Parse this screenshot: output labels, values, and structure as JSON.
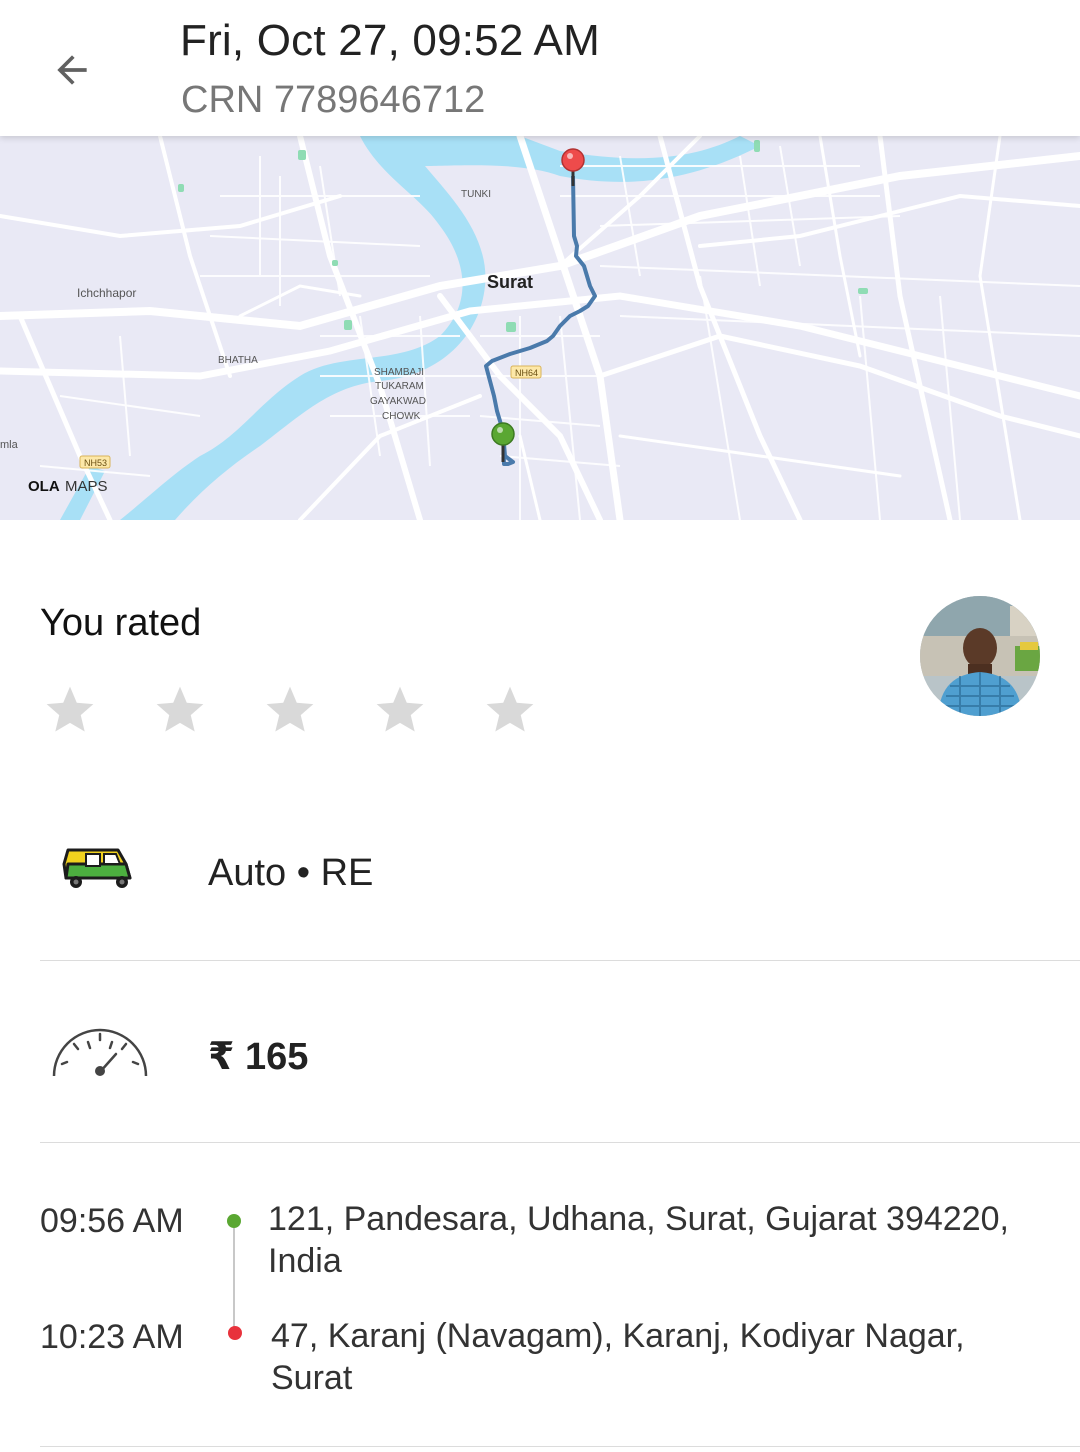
{
  "header": {
    "datetime": "Fri, Oct 27, 09:52 AM",
    "crn": "CRN 7789646712",
    "back_icon": "arrow-left-icon"
  },
  "map": {
    "city_label": "Surat",
    "area_labels": [
      "TUNKI",
      "Ichchhapor",
      "BHATHA",
      "SHAMBAJI",
      "TUKARAM",
      "GAYAKWAD",
      "CHOWK",
      "mla"
    ],
    "road_shields": [
      "NH64",
      "NH53"
    ],
    "brand_bold": "OLA",
    "brand_light": "MAPS",
    "route_color": "#4a7aab",
    "pickup_pin_color": "#5aa732",
    "drop_pin_color": "#e84b4b"
  },
  "rating": {
    "label": "You rated",
    "stars": 5,
    "value": 0,
    "star_icon": "star-icon"
  },
  "ride": {
    "category": "Auto • RE",
    "vehicle_icon": "auto-rickshaw-icon",
    "fare": "₹ 165",
    "fare_icon": "speedometer-icon"
  },
  "trip": {
    "pickup_time": "09:56 AM",
    "pickup_address": "121, Pandesara, Udhana, Surat, Gujarat 394220, India",
    "drop_time": "10:23 AM",
    "drop_address": "47, Karanj (Navagam), Karanj, Kodiyar Nagar, Surat",
    "pickup_color": "#5aa732",
    "drop_color": "#e8323c"
  }
}
